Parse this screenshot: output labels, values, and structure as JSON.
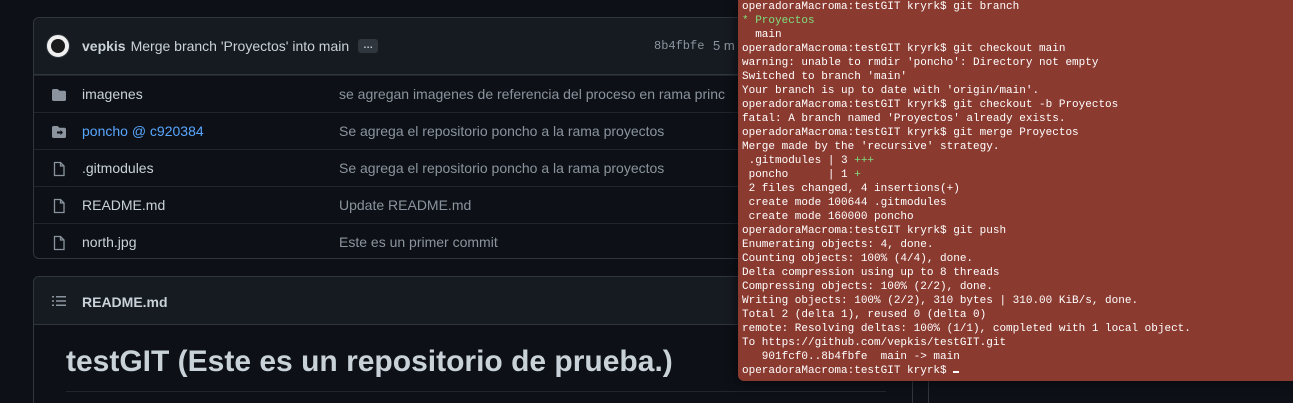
{
  "commit": {
    "author": "vepkis",
    "message": "Merge branch 'Proyectos' into main",
    "ellipsis": "…",
    "hash": "8b4fbfe",
    "time": "5 m"
  },
  "files": [
    {
      "name": "imagenes",
      "type": "folder",
      "message": "se agregan imagenes de referencia del proceso en rama princ"
    },
    {
      "name": "poncho @ c920384",
      "type": "submodule",
      "message": "Se agrega el repositorio poncho a la rama proyectos"
    },
    {
      "name": ".gitmodules",
      "type": "file",
      "message": "Se agrega el repositorio poncho a la rama proyectos"
    },
    {
      "name": "README.md",
      "type": "file",
      "message": "Update README.md"
    },
    {
      "name": "north.jpg",
      "type": "file",
      "message": "Este es un primer commit"
    }
  ],
  "readme": {
    "title": "README.md",
    "heading": "testGIT (Este es un repositorio de prueba.)"
  },
  "colors": {
    "terminal_bg": "#8b3a30",
    "github_bg": "#0d1117",
    "link": "#58a6ff",
    "terminal_green": "#7ee07e"
  },
  "terminal": {
    "lines": [
      "operadoraMacroma:testGIT kryrk$ git branch",
      "* Proyectos",
      "  main",
      "operadoraMacroma:testGIT kryrk$ git checkout main",
      "warning: unable to rmdir 'poncho': Directory not empty",
      "Switched to branch 'main'",
      "Your branch is up to date with 'origin/main'.",
      "operadoraMacroma:testGIT kryrk$ git checkout -b Proyectos",
      "fatal: A branch named 'Proyectos' already exists.",
      "operadoraMacroma:testGIT kryrk$ git merge Proyectos",
      "Merge made by the 'recursive' strategy.",
      " .gitmodules | 3 +++",
      " poncho      | 1 +",
      " 2 files changed, 4 insertions(+)",
      " create mode 100644 .gitmodules",
      " create mode 160000 poncho",
      "operadoraMacroma:testGIT kryrk$ git push",
      "Enumerating objects: 4, done.",
      "Counting objects: 100% (4/4), done.",
      "Delta compression using up to 8 threads",
      "Compressing objects: 100% (2/2), done.",
      "Writing objects: 100% (2/2), 310 bytes | 310.00 KiB/s, done.",
      "Total 2 (delta 1), reused 0 (delta 0)",
      "remote: Resolving deltas: 100% (1/1), completed with 1 local object.",
      "To https://github.com/vepkis/testGIT.git",
      "   901fcf0..8b4fbfe  main -> main",
      "operadoraMacroma:testGIT kryrk$ "
    ]
  }
}
